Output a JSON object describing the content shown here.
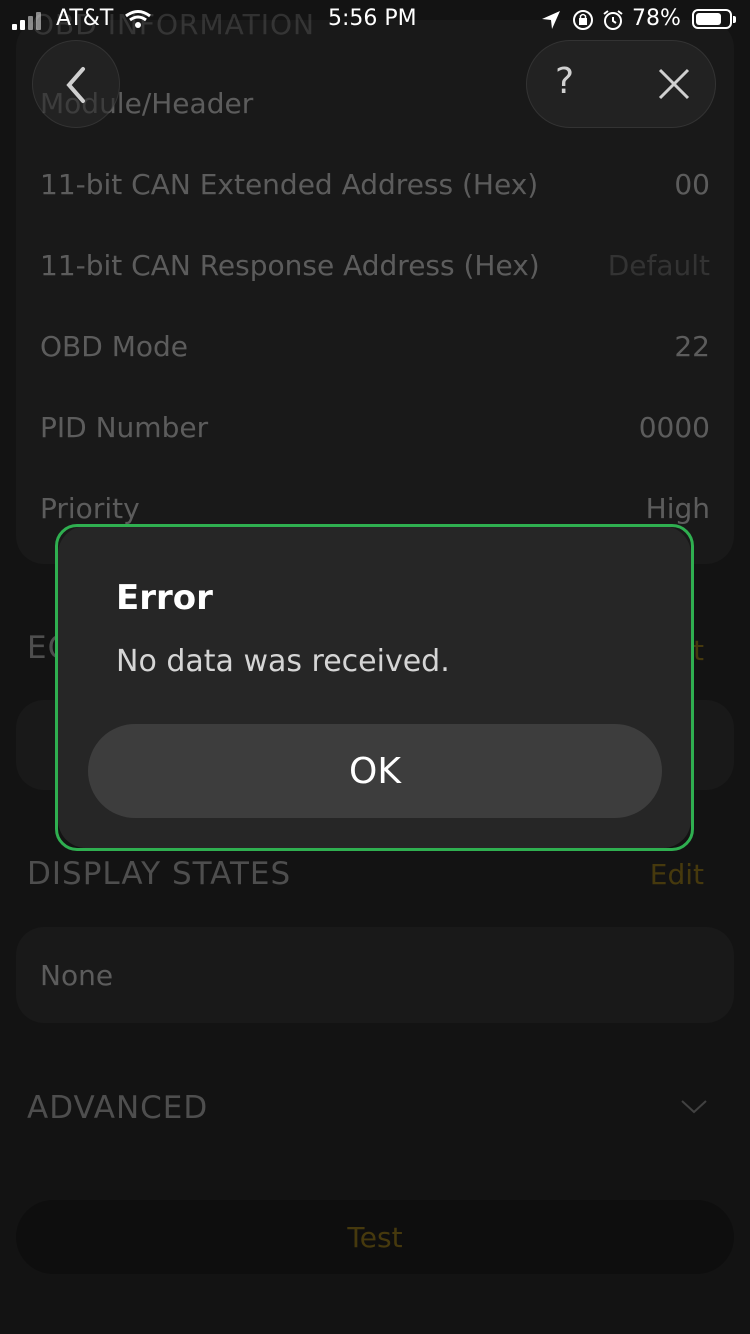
{
  "status_bar": {
    "carrier": "AT&T",
    "time": "5:56 PM",
    "battery_percent": "78%",
    "battery_level": 0.78
  },
  "nav": {
    "back_icon": "chevron-left-icon",
    "help_label": "?",
    "close_icon": "close-icon"
  },
  "obd_information": {
    "section_title": "OBD INFORMATION",
    "rows": [
      {
        "label": "Module/Header",
        "value": ""
      },
      {
        "label": "11-bit CAN Extended Address (Hex)",
        "value": "00"
      },
      {
        "label": "11-bit CAN Response Address (Hex)",
        "value": "Default"
      },
      {
        "label": "OBD Mode",
        "value": "22"
      },
      {
        "label": "PID Number",
        "value": "0000"
      },
      {
        "label": "Priority",
        "value": "High"
      }
    ]
  },
  "equation": {
    "title": "EQUATION",
    "edit_label": "Edit"
  },
  "display_states": {
    "title": "DISPLAY STATES",
    "edit_label": "Edit",
    "value": "None"
  },
  "advanced": {
    "title": "ADVANCED",
    "expand_icon": "chevron-down-icon"
  },
  "test_button_label": "Test",
  "dialog": {
    "title": "Error",
    "message": "No data was received.",
    "ok_label": "OK"
  },
  "colors": {
    "accent_gold": "#806919",
    "highlight_green": "#2faf50",
    "background": "#232323"
  }
}
